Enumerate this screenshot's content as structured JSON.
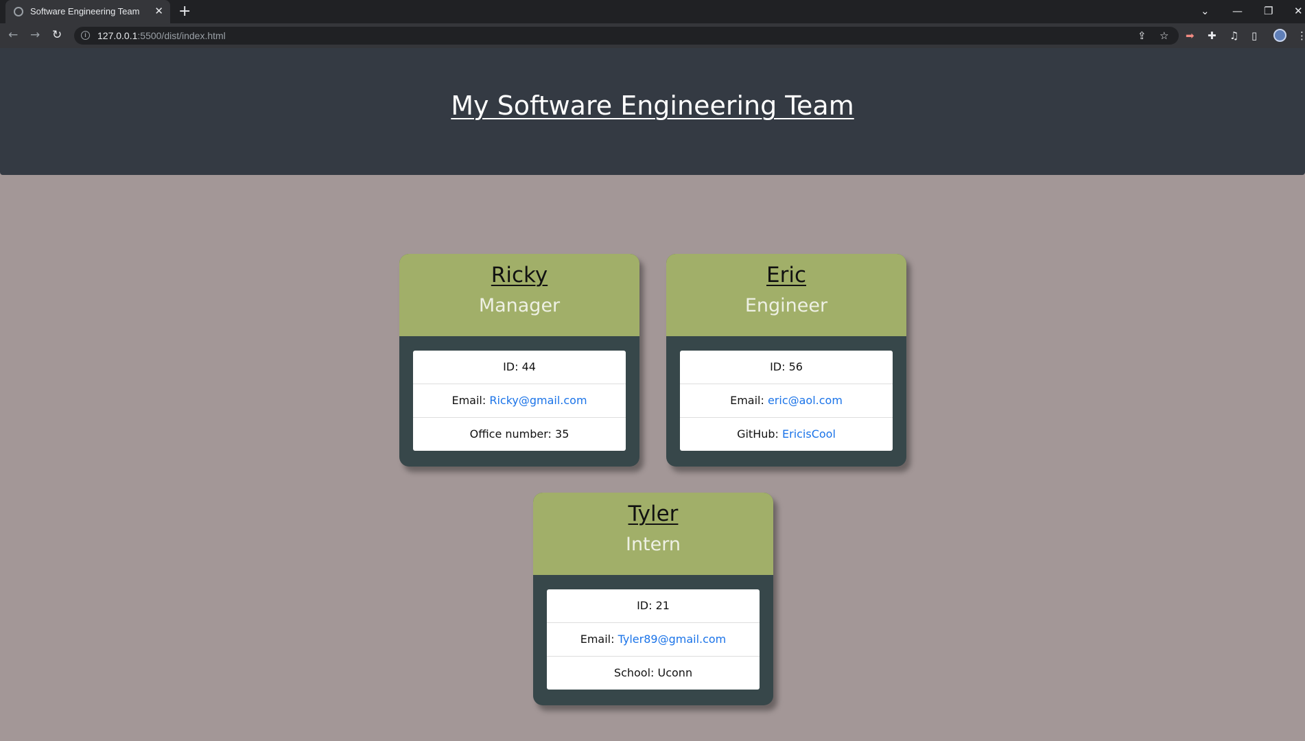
{
  "browser": {
    "tab_title": "Software Engineering Team",
    "tab_close": "✕",
    "new_tab": "+",
    "url_host": "127.0.0.1",
    "url_path": ":5500/dist/index.html"
  },
  "icons": {
    "back": "←",
    "forward": "→",
    "reload": "↻",
    "share": "⇪",
    "star": "☆",
    "puzzle": "✚",
    "media": "♫",
    "sidepanel": "▯",
    "menu": "⋮",
    "tab_search": "⌄",
    "minimize": "—",
    "restore": "❐",
    "close": "✕",
    "extension_red": "➡"
  },
  "page": {
    "title": "My Software Engineering Team"
  },
  "team": [
    {
      "name": "Ricky",
      "role": "Manager",
      "id_label": "ID: 44",
      "email_prefix": "Email: ",
      "email": "Ricky@gmail.com",
      "extra_label": "Office number: 35",
      "extra_link": ""
    },
    {
      "name": "Eric",
      "role": "Engineer",
      "id_label": "ID: 56",
      "email_prefix": "Email: ",
      "email": "eric@aol.com",
      "extra_label": "GitHub: ",
      "extra_link": "EricisCool"
    },
    {
      "name": "Tyler",
      "role": "Intern",
      "id_label": "ID: 21",
      "email_prefix": "Email: ",
      "email": "Tyler89@gmail.com",
      "extra_label": "School: Uconn",
      "extra_link": ""
    }
  ],
  "colors": {
    "page_background": "#a39797",
    "header_background": "#343a43",
    "card_header": "#a1af69",
    "card_body": "#37474a",
    "link": "#1a73e8"
  }
}
